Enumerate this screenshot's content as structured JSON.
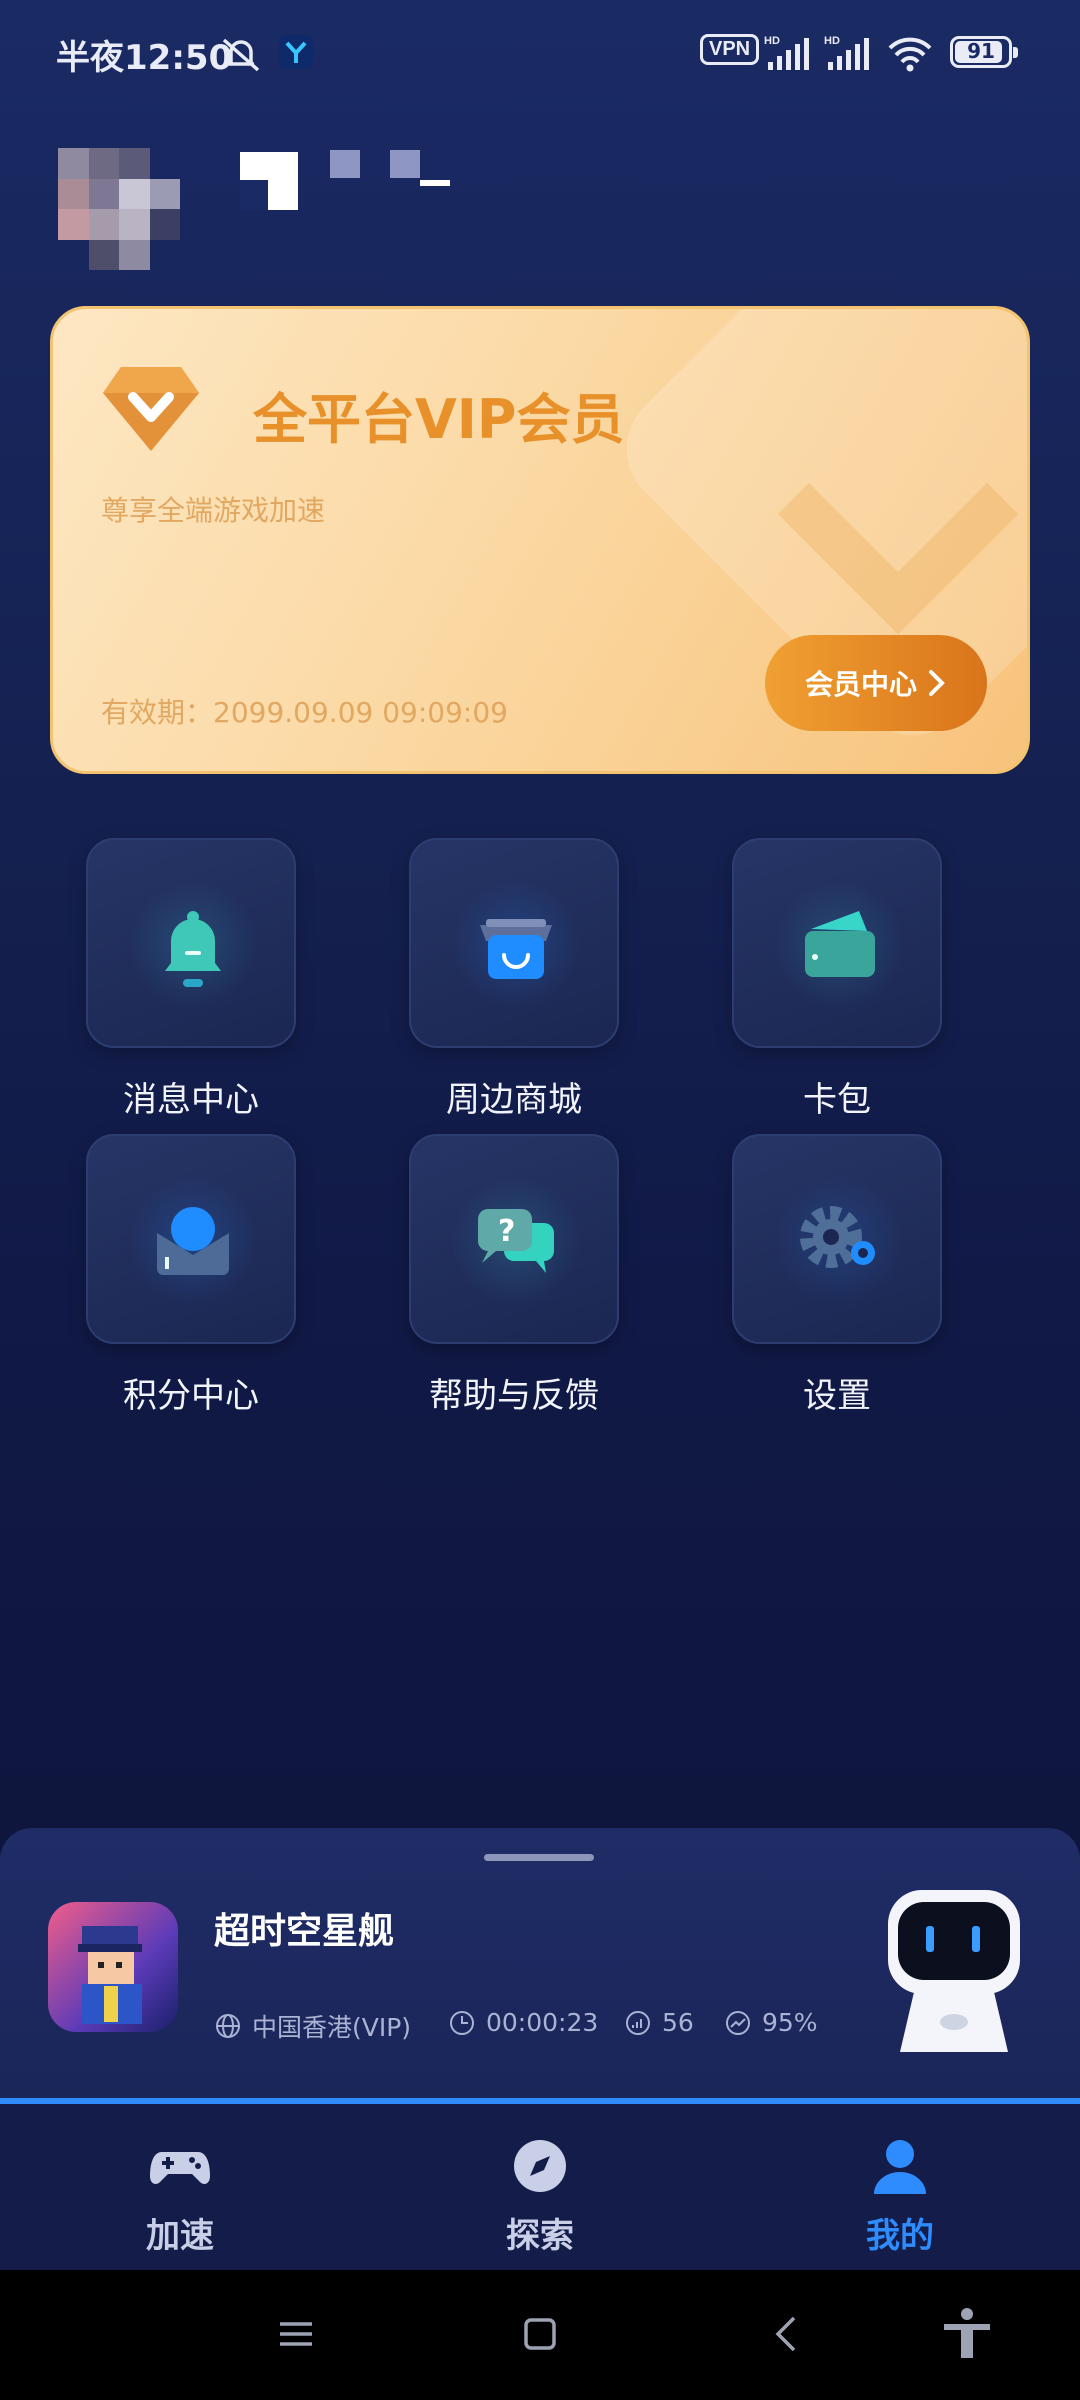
{
  "status_bar": {
    "time": "半夜12:50",
    "vpn": "VPN",
    "battery": "91",
    "battery_level": 0.91,
    "icons": [
      "mute-bell-icon",
      "app-y-icon",
      "hd-signal-icon",
      "hd-signal-icon",
      "wifi-icon",
      "battery-icon"
    ]
  },
  "vip_card": {
    "title": "全平台VIP会员",
    "subtitle": "尊享全端游戏加速",
    "expiry": "有效期：2099.09.09 09:09:09",
    "button_label": "会员中心"
  },
  "grid": {
    "items": [
      {
        "label": "消息中心",
        "icon": "bell-icon"
      },
      {
        "label": "周边商城",
        "icon": "shop-icon"
      },
      {
        "label": "卡包",
        "icon": "wallet-icon"
      },
      {
        "label": "积分中心",
        "icon": "mail-points-icon"
      },
      {
        "label": "帮助与反馈",
        "icon": "help-chat-icon"
      },
      {
        "label": "设置",
        "icon": "gear-icon"
      }
    ]
  },
  "now_playing": {
    "game_title": "超时空星舰",
    "region": "中国香港(VIP)",
    "duration": "00:00:23",
    "latency": "56",
    "stability": "95%"
  },
  "tabs": [
    {
      "label": "加速",
      "icon": "gamepad-icon",
      "active": false
    },
    {
      "label": "探索",
      "icon": "compass-icon",
      "active": false
    },
    {
      "label": "我的",
      "icon": "user-icon",
      "active": true
    }
  ],
  "colors": {
    "accent_blue": "#2f8cff",
    "vip_gold": "#e8902a",
    "tab_inactive": "#c9cfe6"
  }
}
